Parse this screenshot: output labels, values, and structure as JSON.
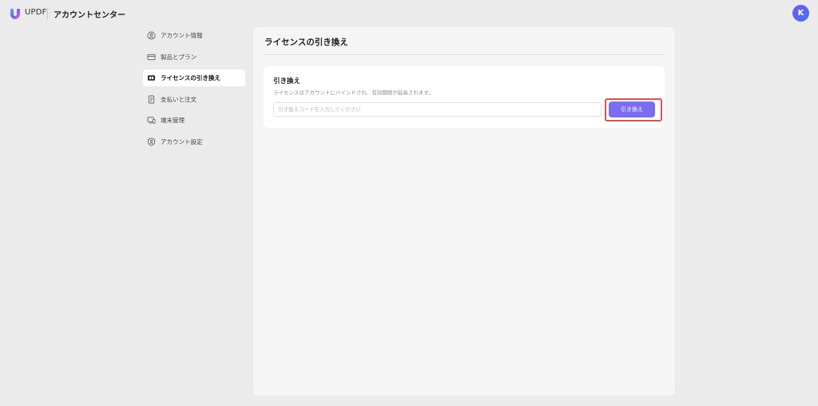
{
  "header": {
    "brand": "UPDF",
    "title": "アカウントセンター",
    "avatar_initial": "K",
    "avatar_color": "#5b67f3"
  },
  "sidebar": {
    "items": [
      {
        "label": "アカウント情報",
        "icon": "user-circle-icon",
        "active": false
      },
      {
        "label": "製品とプラン",
        "icon": "card-icon",
        "active": false
      },
      {
        "label": "ライセンスの引き換え",
        "icon": "ticket-icon",
        "active": true
      },
      {
        "label": "支払いと注文",
        "icon": "receipt-icon",
        "active": false
      },
      {
        "label": "端末管理",
        "icon": "devices-icon",
        "active": false
      },
      {
        "label": "アカウント設定",
        "icon": "user-shield-icon",
        "active": false
      }
    ]
  },
  "main": {
    "title": "ライセンスの引き換え",
    "card": {
      "title": "引き換え",
      "description": "ライセンスはアカウントにバインドされ、有効期限が延長されます。",
      "input_value": "",
      "input_placeholder": "引き換えコードを入力してください",
      "button_label": "引き換え"
    }
  },
  "colors": {
    "accent": "#7b6cf2",
    "highlight": "#d9534f",
    "background": "#ebebeb"
  }
}
